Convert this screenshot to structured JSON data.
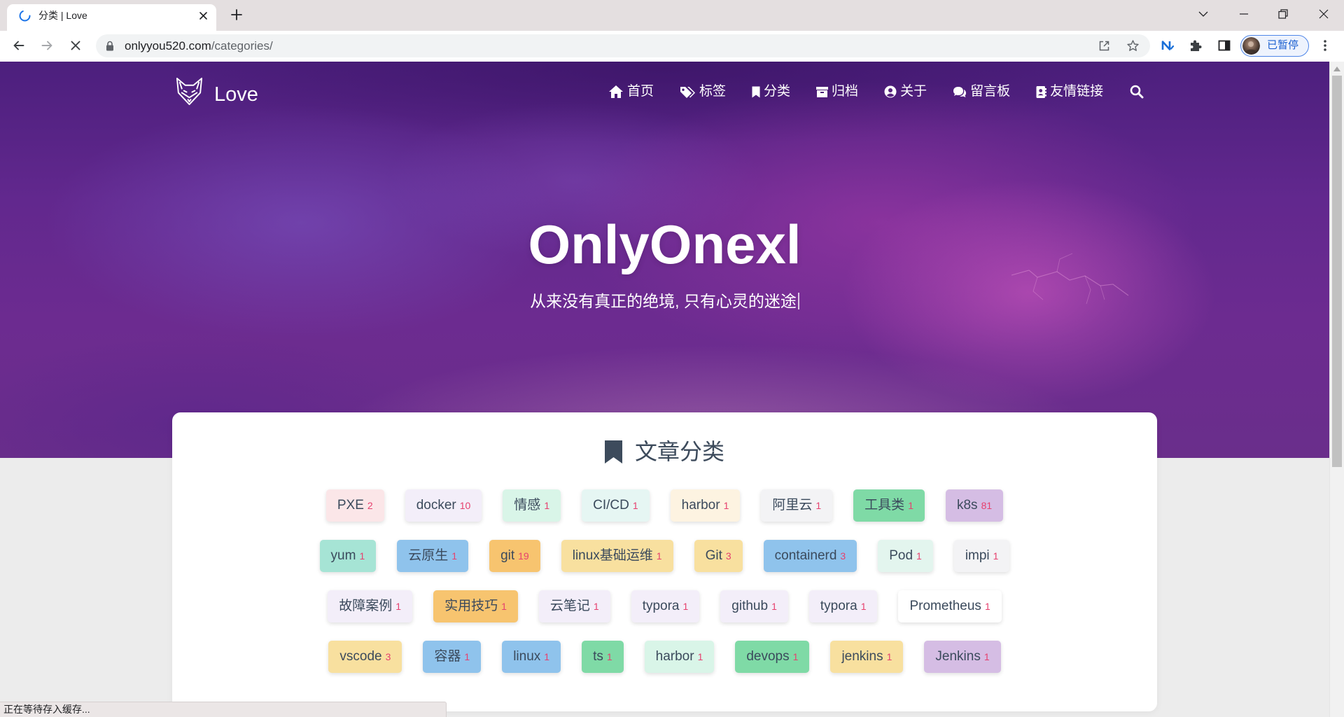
{
  "browser": {
    "tab": {
      "title": "分类 | Love",
      "loading_icon": "loading-spinner-icon",
      "close_icon": "close-icon"
    },
    "new_tab_icon": "plus-icon",
    "window_controls": [
      "chevron-down-icon",
      "minimize-icon",
      "restore-icon",
      "close-icon"
    ],
    "toolbar": {
      "back_icon": "back-arrow-icon",
      "forward_icon": "forward-arrow-icon",
      "stop_icon": "stop-loading-icon"
    },
    "omnibox": {
      "security_icon": "lock-icon",
      "url_host": "onlyyou520.com",
      "url_path": "/categories/",
      "share_icon": "share-icon",
      "bookmark_icon": "star-icon"
    },
    "extensions": [
      "n-extension-icon",
      "puzzle-icon",
      "side-panel-icon"
    ],
    "profile": {
      "status": "已暂停",
      "avatar": "avatar"
    },
    "menu_icon": "more-vert-icon",
    "status_bar": "正在等待存入缓存..."
  },
  "site": {
    "brand": {
      "logo_icon": "fox-logo-icon",
      "name": "Love"
    },
    "nav": [
      {
        "icon": "home-icon",
        "label": "首页"
      },
      {
        "icon": "tags-icon",
        "label": "标签"
      },
      {
        "icon": "bookmark-icon",
        "label": "分类"
      },
      {
        "icon": "archive-icon",
        "label": "归档"
      },
      {
        "icon": "user-circle-icon",
        "label": "关于"
      },
      {
        "icon": "comments-icon",
        "label": "留言板"
      },
      {
        "icon": "address-book-icon",
        "label": "友情链接"
      }
    ],
    "search_icon": "search-icon"
  },
  "hero": {
    "title": "OnlyOnexl",
    "subtitle": "从来没有真正的绝境, 只有心灵的迷途"
  },
  "categories": {
    "heading_icon": "bookmark-icon",
    "heading": "文章分类",
    "items": [
      {
        "name": "PXE",
        "count": 2,
        "color": "#fbe6e8"
      },
      {
        "name": "docker",
        "count": 10,
        "color": "#f3eef9"
      },
      {
        "name": "情感",
        "count": 1,
        "color": "#d9f5e8"
      },
      {
        "name": "CI/CD",
        "count": 1,
        "color": "#e6f6f3"
      },
      {
        "name": "harbor",
        "count": 1,
        "color": "#fdf3e1"
      },
      {
        "name": "阿里云",
        "count": 1,
        "color": "#f3f3f5"
      },
      {
        "name": "工具类",
        "count": 1,
        "color": "#7fdaa6"
      },
      {
        "name": "k8s",
        "count": 81,
        "color": "#d5bde4"
      },
      {
        "name": "yum",
        "count": 1,
        "color": "#a6e4d5"
      },
      {
        "name": "云原生",
        "count": 1,
        "color": "#8fc3ec"
      },
      {
        "name": "git",
        "count": 19,
        "color": "#f7c46f"
      },
      {
        "name": "linux基础运维",
        "count": 1,
        "color": "#f8e09f"
      },
      {
        "name": "Git",
        "count": 3,
        "color": "#f8e09f"
      },
      {
        "name": "containerd",
        "count": 3,
        "color": "#8fc3ec"
      },
      {
        "name": "Pod",
        "count": 1,
        "color": "#e3f5ee"
      },
      {
        "name": "impi",
        "count": 1,
        "color": "#f3f3f5"
      },
      {
        "name": "故障案例",
        "count": 1,
        "color": "#f3eef9"
      },
      {
        "name": "实用技巧",
        "count": 1,
        "color": "#f7c46f"
      },
      {
        "name": "云笔记",
        "count": 1,
        "color": "#f3eef9"
      },
      {
        "name": "typora",
        "count": 1,
        "color": "#f3eef9"
      },
      {
        "name": "github",
        "count": 1,
        "color": "#f3eef9"
      },
      {
        "name": "typora",
        "count": 1,
        "color": "#f3eef9"
      },
      {
        "name": "Prometheus",
        "count": 1,
        "color": "#ffffff"
      },
      {
        "name": "vscode",
        "count": 3,
        "color": "#f8e09f"
      },
      {
        "name": "容器",
        "count": 1,
        "color": "#8fc3ec"
      },
      {
        "name": "linux",
        "count": 1,
        "color": "#8fc3ec"
      },
      {
        "name": "ts",
        "count": 1,
        "color": "#7fdaa6"
      },
      {
        "name": "harbor",
        "count": 1,
        "color": "#d9f5e8"
      },
      {
        "name": "devops",
        "count": 1,
        "color": "#7fdaa6"
      },
      {
        "name": "jenkins",
        "count": 1,
        "color": "#f8e09f"
      },
      {
        "name": "Jenkins",
        "count": 1,
        "color": "#d5bde4"
      }
    ]
  },
  "colors": {
    "count": "#e6406e",
    "tag_text": "#3b4a5c",
    "profile_accent": "#1a5fd0",
    "loading": "#1a73e8"
  }
}
